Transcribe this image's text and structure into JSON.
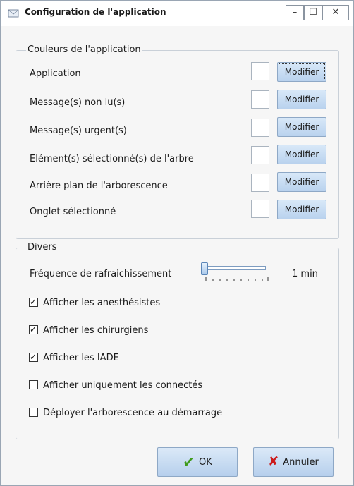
{
  "window": {
    "title": "Configuration de l'application",
    "min_symbol": "–",
    "max_symbol": "☐",
    "close_symbol": "✕"
  },
  "colors_group": {
    "title": "Couleurs de l'application",
    "rows": [
      {
        "label": "Application",
        "button": "Modifier"
      },
      {
        "label": "Message(s) non lu(s)",
        "button": "Modifier"
      },
      {
        "label": "Message(s) urgent(s)",
        "button": "Modifier"
      },
      {
        "label": "Elément(s) sélectionné(s) de l'arbre",
        "button": "Modifier"
      },
      {
        "label": "Arrière plan de l'arborescence",
        "button": "Modifier"
      },
      {
        "label": "Onglet sélectionné",
        "button": "Modifier"
      }
    ]
  },
  "divers_group": {
    "title": "Divers",
    "refresh_label": "Fréquence de rafraichissement",
    "refresh_value": "1 min",
    "refresh_level": 0.0,
    "checks": [
      {
        "label": "Afficher les anesthésistes",
        "checked": true
      },
      {
        "label": "Afficher les chirurgiens",
        "checked": true
      },
      {
        "label": "Afficher les IADE",
        "checked": true
      },
      {
        "label": "Afficher uniquement les connectés",
        "checked": false
      },
      {
        "label": "Déployer l'arborescence au démarrage",
        "checked": false
      }
    ]
  },
  "buttons": {
    "ok": "OK",
    "cancel": "Annuler"
  },
  "colors": {
    "accent_button": "#c8ddf3",
    "ok_icon": "#3f9b1c",
    "cancel_icon": "#cc1b1b"
  },
  "icons": {
    "app": "envelope-icon",
    "ok": "checkmark-icon",
    "cancel": "cross-icon"
  }
}
